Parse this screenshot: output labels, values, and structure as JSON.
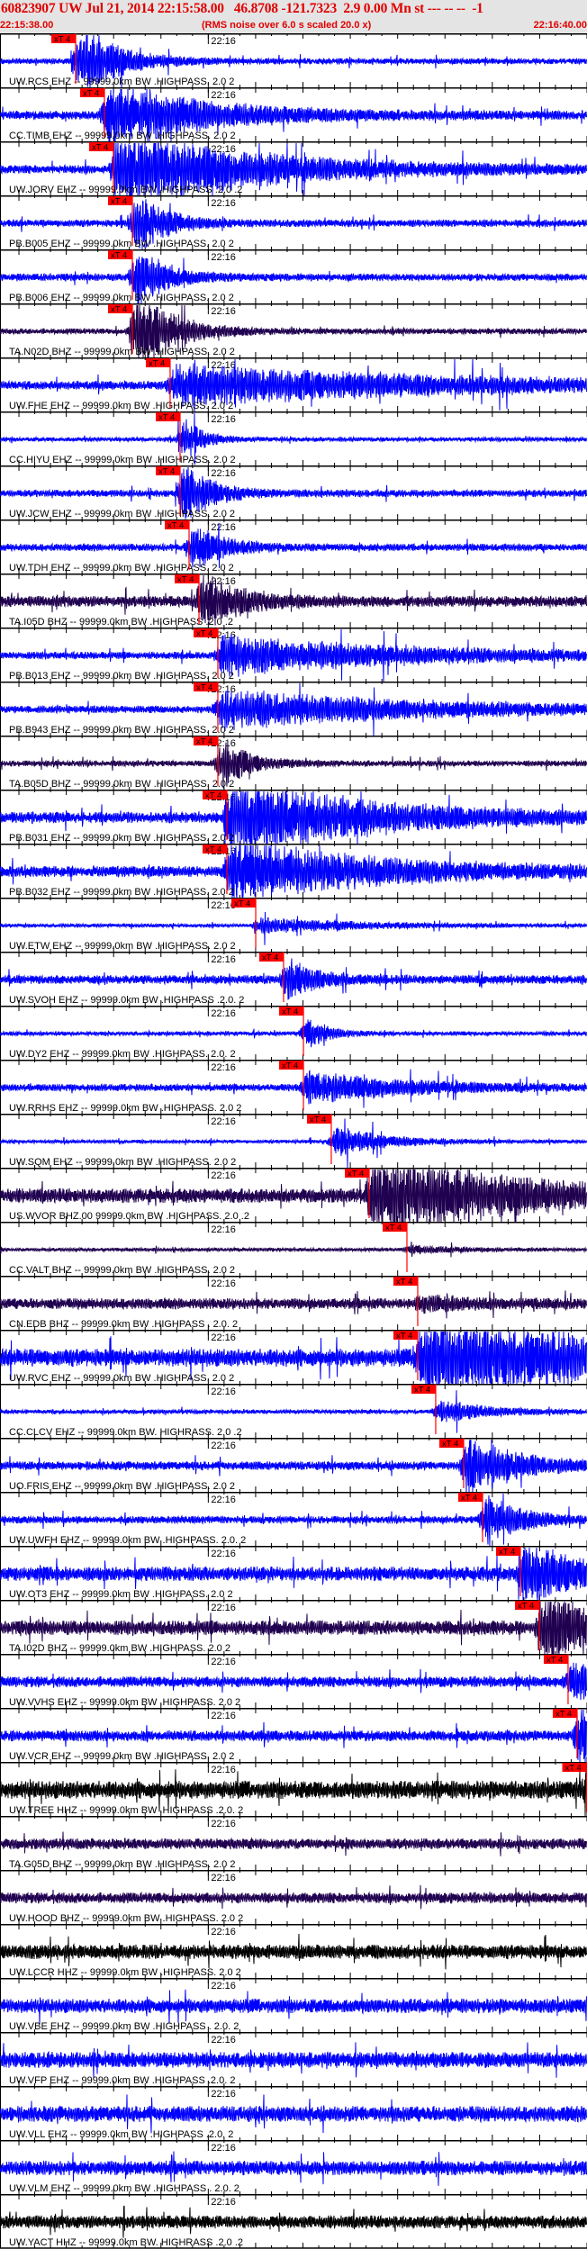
{
  "header": {
    "title": "60823907 UW Jul 21, 2014 22:15:58.00   46.8708 -121.7323  2.9 0.00 Mn st --- -- --  -1",
    "start_time": "22:15:38.00",
    "noise_note": "(RMS noise over 6.0 s scaled 20.0 x)",
    "end_time": "22:16:40.00"
  },
  "time_axis": {
    "span_seconds": 62,
    "minute_tick_offset_seconds": 22,
    "minute_tick_label": "22:16",
    "major_tick_seconds": 5,
    "first_tick_offset_seconds": 2
  },
  "pick_label": "xT 4",
  "colors": {
    "blue": "#0000ff",
    "navy": "#200050",
    "black": "#000000",
    "pick": "#ff0000",
    "header_text": "#e00000"
  },
  "traces": [
    {
      "label": "UW.RCS EHZ -- 99999.0km BW .HIGHPASS. 2.0  2",
      "color": "blue",
      "pick_s": 7.99,
      "noise": 0.08,
      "peak": 1.0,
      "dur": 4
    },
    {
      "label": "CC.TIMB EHZ -- 99999.0km BW .HIGHPASS. 2.0  2",
      "color": "blue",
      "pick_s": 11.03,
      "noise": 0.12,
      "peak": 0.9,
      "dur": 10
    },
    {
      "label": "UW.JORV EHZ -- 99999.0km BW .HIGHPASS .2.0 .2",
      "color": "blue",
      "pick_s": 11.98,
      "noise": 0.12,
      "peak": 1.0,
      "dur": 15
    },
    {
      "label": "PB.B005 EHZ -- 99999.0km BW .HIGHPASS. 2.0  2",
      "color": "blue",
      "pick_s": 13.98,
      "noise": 0.1,
      "peak": 0.8,
      "dur": 3
    },
    {
      "label": "PB.B006 EHZ -- 99999.0km BW .HIGHPASS. 2.0  2",
      "color": "blue",
      "pick_s": 13.98,
      "noise": 0.1,
      "peak": 0.8,
      "dur": 3
    },
    {
      "label": "TA.N02D BHZ -- 99999.0km BW .HIGHPASS. 2.0  2",
      "color": "navy",
      "pick_s": 13.98,
      "noise": 0.08,
      "peak": 1.0,
      "dur": 4
    },
    {
      "label": "UW.FHE EHZ -- 99999.0km BW .HIGHPASS. 2.0  2",
      "color": "blue",
      "pick_s": 17.97,
      "noise": 0.12,
      "peak": 0.5,
      "dur": 30
    },
    {
      "label": "CC.HIYU EHZ -- 99999.0km BW .HIGHPASS. 2.0  2",
      "color": "blue",
      "pick_s": 19.02,
      "noise": 0.06,
      "peak": 0.5,
      "dur": 2
    },
    {
      "label": "UW.JCW EHZ -- 99999.0km BW .HIGHPASS. 2.0  2",
      "color": "blue",
      "pick_s": 19.02,
      "noise": 0.1,
      "peak": 0.7,
      "dur": 3
    },
    {
      "label": "UW.TDH EHZ -- 99999.0km BW .HIGHPASS. 2.0  2",
      "color": "blue",
      "pick_s": 19.97,
      "noise": 0.1,
      "peak": 0.6,
      "dur": 3
    },
    {
      "label": "TA.I05D BHZ -- 99999.0km BW .HIGHPASS .2.0 .2",
      "color": "navy",
      "pick_s": 21.02,
      "noise": 0.15,
      "peak": 0.7,
      "dur": 4
    },
    {
      "label": "PB.B013 EHZ -- 99999.0km BW .HIGHPASS. 2.0  2",
      "color": "blue",
      "pick_s": 23.01,
      "noise": 0.1,
      "peak": 0.5,
      "dur": 20
    },
    {
      "label": "PB.B943 EHZ -- 99999.0km BW .HIGHPASS. 2.0  2",
      "color": "blue",
      "pick_s": 23.01,
      "noise": 0.1,
      "peak": 0.5,
      "dur": 20
    },
    {
      "label": "TA.B05D BHZ -- 99999.0km BW .HIGHPASS. 2.0  2",
      "color": "navy",
      "pick_s": 23.01,
      "noise": 0.08,
      "peak": 0.6,
      "dur": 3
    },
    {
      "label": "PB.B031 EHZ -- 99999.0km BW .HIGHPASS. 2.0  2",
      "color": "blue",
      "pick_s": 23.96,
      "noise": 0.15,
      "peak": 1.0,
      "dur": 15
    },
    {
      "label": "PB.B032 EHZ -- 99999.0km BW .HIGHPASS. 2.0  2",
      "color": "blue",
      "pick_s": 23.96,
      "noise": 0.15,
      "peak": 0.8,
      "dur": 15
    },
    {
      "label": "UW.ETW EHZ -- 99999.0km BW .HIGHPASS. 2.0  2",
      "color": "blue",
      "pick_s": 27.01,
      "noise": 0.05,
      "peak": 0.2,
      "dur": 10
    },
    {
      "label": "UW.SVOH EHZ -- 99999.0km BW .HIGHPASS .2.0. 2",
      "color": "blue",
      "pick_s": 29.95,
      "noise": 0.12,
      "peak": 0.5,
      "dur": 3
    },
    {
      "label": "UW.DY2 EHZ -- 99999.0km BW .HIGHPASS. 2.0. 2",
      "color": "blue",
      "pick_s": 32.05,
      "noise": 0.06,
      "peak": 0.4,
      "dur": 2
    },
    {
      "label": "UW.RRHS EHZ -- 99999.0km BW .HIGHPASS. 2.0  2",
      "color": "blue",
      "pick_s": 32.05,
      "noise": 0.1,
      "peak": 0.4,
      "dur": 10
    },
    {
      "label": "UW.SQM EHZ -- 99999.0km BW .HIGHPASS. 2.0  2",
      "color": "blue",
      "pick_s": 34.99,
      "noise": 0.05,
      "peak": 0.4,
      "dur": 5
    },
    {
      "label": "US.WVOR BHZ.00 99999.0km BW .HIGHPASS. 2.0 .2",
      "color": "navy",
      "pick_s": 38.99,
      "noise": 0.2,
      "peak": 1.0,
      "dur": 15
    },
    {
      "label": "CC.VALT BHZ -- 99999.0km BW .HIGHPASS. 2.0  2",
      "color": "navy",
      "pick_s": 42.98,
      "noise": 0.05,
      "peak": 0.1,
      "dur": 5
    },
    {
      "label": "CN.EDB BHZ -- 99999.0km BW .HIGHPASS . 2.0. 2",
      "color": "navy",
      "pick_s": 44.12,
      "noise": 0.15,
      "peak": 0.15,
      "dur": 5
    },
    {
      "label": "UW.RVC EHZ -- 99999.0km BW .HIGHPASS. 2.0  2",
      "color": "blue",
      "pick_s": 44.12,
      "noise": 0.25,
      "peak": 1.0,
      "dur": 20
    },
    {
      "label": "CC.CLCV EHZ -- 99999.0km BW. HIGHRASS. 2.0 .2",
      "color": "blue",
      "pick_s": 46.02,
      "noise": 0.06,
      "peak": 0.3,
      "dur": 5
    },
    {
      "label": "UO.FRIS EHZ -- 99999.0km BW .HIGHPASS. 2.0  2",
      "color": "blue",
      "pick_s": 48.97,
      "noise": 0.12,
      "peak": 0.8,
      "dur": 5
    },
    {
      "label": "UW.UWFH EHZ -- 99999.0km BW .HIGHPASS. 2.0. 2",
      "color": "blue",
      "pick_s": 50.97,
      "noise": 0.1,
      "peak": 0.6,
      "dur": 4
    },
    {
      "label": "UW.OT3 EHZ -- 99999.0km BW .HIGHPASS. 2.0  2",
      "color": "blue",
      "pick_s": 54.96,
      "noise": 0.2,
      "peak": 0.8,
      "dur": 5
    },
    {
      "label": "TA.I02D BHZ -- 99999.0km BW .HIGHPASS. 2.0  2",
      "color": "navy",
      "pick_s": 56.96,
      "noise": 0.2,
      "peak": 1.0,
      "dur": 6
    },
    {
      "label": "UW.VVHS EHZ -- 99999.0km BW .HIGHPASS. 2.0  2",
      "color": "blue",
      "pick_s": 60.0,
      "noise": 0.15,
      "peak": 0.5,
      "dur": 3
    },
    {
      "label": "UW.VCR EHZ -- 99999.0km BW .HIGHPASS. 2.0  2",
      "color": "blue",
      "pick_s": 60.95,
      "noise": 0.15,
      "peak": 1.0,
      "dur": 2
    },
    {
      "label": "UW.TREE HHZ -- 99999.0km BW .HIGHPASS .2.0. 2",
      "color": "black",
      "pick_s": 62.0,
      "noise": 0.25,
      "peak": 0.8,
      "dur": 2
    },
    {
      "label": "TA.G05D BHZ -- 99999.0km BW .HIGHPASS. 2.0  2",
      "color": "navy",
      "pick_s": null,
      "noise": 0.15,
      "peak": 0,
      "dur": 0
    },
    {
      "label": "UW.HOOD BHZ -- 99999.0km BW .HIGHPASS. 2.0  2",
      "color": "navy",
      "pick_s": null,
      "noise": 0.15,
      "peak": 0,
      "dur": 0
    },
    {
      "label": "UW.LCCR HHZ -- 99999.0km BW .HIGHPASS. 2.0  2",
      "color": "black",
      "pick_s": null,
      "noise": 0.2,
      "peak": 0,
      "dur": 0
    },
    {
      "label": "UW.VBE EHZ -- 99999.0km BW .HIGHPASS . 2.0. 2",
      "color": "blue",
      "pick_s": null,
      "noise": 0.2,
      "peak": 0,
      "dur": 0
    },
    {
      "label": "UW.VFP EHZ -- 99999.0km BW .HIGHPASS .2.0. 2",
      "color": "blue",
      "pick_s": null,
      "noise": 0.22,
      "peak": 0,
      "dur": 0
    },
    {
      "label": "UW.VLL EHZ -- 99999.0km BW .HIGHPASS .2.0. 2",
      "color": "blue",
      "pick_s": null,
      "noise": 0.22,
      "peak": 0,
      "dur": 0
    },
    {
      "label": "UW.VLM EHZ -- 99999.0km BW .HIGHPASS . 2.0. 2",
      "color": "blue",
      "pick_s": null,
      "noise": 0.2,
      "peak": 0,
      "dur": 0
    },
    {
      "label": "UW.YACT HHZ -- 99999.0km BW. HIGHRASS .2.0 .2",
      "color": "black",
      "pick_s": null,
      "noise": 0.18,
      "peak": 0,
      "dur": 0
    }
  ]
}
